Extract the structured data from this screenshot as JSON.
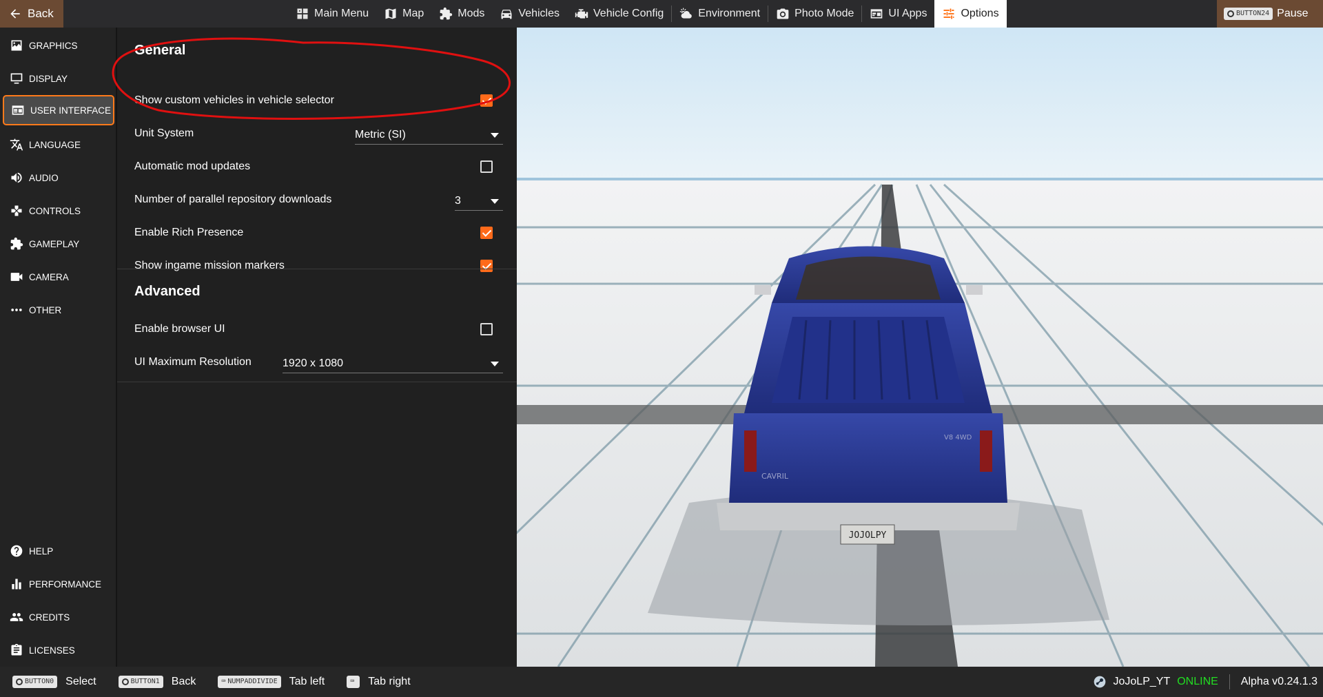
{
  "topbar": {
    "back_label": "Back",
    "tabs": [
      {
        "label": "Main Menu",
        "icon": "main-menu-icon"
      },
      {
        "label": "Map",
        "icon": "map-icon"
      },
      {
        "label": "Mods",
        "icon": "puzzle-icon"
      },
      {
        "label": "Vehicles",
        "icon": "car-icon"
      },
      {
        "label": "Vehicle Config",
        "icon": "engine-icon"
      },
      {
        "label": "Environment",
        "icon": "weather-icon"
      },
      {
        "label": "Photo Mode",
        "icon": "camera-icon"
      },
      {
        "label": "UI Apps",
        "icon": "ui-apps-icon"
      },
      {
        "label": "Options",
        "icon": "sliders-icon",
        "active": true
      }
    ],
    "pause_chip": "BUTTON24",
    "pause_label": "Pause"
  },
  "sidebar": {
    "items": [
      {
        "label": "GRAPHICS",
        "icon": "image-icon"
      },
      {
        "label": "DISPLAY",
        "icon": "monitor-icon"
      },
      {
        "label": "USER INTERFACE",
        "icon": "user-interface-icon",
        "active": true
      },
      {
        "label": "LANGUAGE",
        "icon": "translate-icon"
      },
      {
        "label": "AUDIO",
        "icon": "speaker-icon"
      },
      {
        "label": "CONTROLS",
        "icon": "gamepad-icon"
      },
      {
        "label": "GAMEPLAY",
        "icon": "puzzle-icon"
      },
      {
        "label": "CAMERA",
        "icon": "video-camera-icon"
      },
      {
        "label": "OTHER",
        "icon": "more-icon"
      }
    ],
    "bottom_items": [
      {
        "label": "HELP",
        "icon": "help-icon"
      },
      {
        "label": "PERFORMANCE",
        "icon": "bar-chart-icon"
      },
      {
        "label": "CREDITS",
        "icon": "people-icon"
      },
      {
        "label": "LICENSES",
        "icon": "clipboard-icon"
      }
    ]
  },
  "settings": {
    "general_title": "General",
    "advanced_title": "Advanced",
    "general": [
      {
        "label": "Show custom vehicles in vehicle selector",
        "type": "checkbox",
        "checked": true
      },
      {
        "label": "Unit System",
        "type": "select",
        "value": "Metric (SI)"
      },
      {
        "label": "Automatic mod updates",
        "type": "checkbox",
        "checked": false
      },
      {
        "label": "Number of parallel repository downloads",
        "type": "select",
        "value": "3"
      },
      {
        "label": "Enable Rich Presence",
        "type": "checkbox",
        "checked": true
      },
      {
        "label": "Show ingame mission markers",
        "type": "checkbox",
        "checked": true
      }
    ],
    "advanced": [
      {
        "label": "Enable browser UI",
        "type": "checkbox",
        "checked": false
      },
      {
        "label": "UI Maximum Resolution",
        "type": "select",
        "value": "1920 x 1080"
      }
    ]
  },
  "viewport": {
    "license_plate": "JOJOLPY",
    "badge_left": "CAVRIL",
    "badge_right": "V8 4WD"
  },
  "bottombar": {
    "hints": [
      {
        "chip": "BUTTON0",
        "label": "Select"
      },
      {
        "chip": "BUTTON1",
        "label": "Back"
      },
      {
        "chip": "NUMPADDIVIDE",
        "label": "Tab left"
      },
      {
        "chip": "",
        "label": "Tab right"
      }
    ],
    "username": "JoJoLP_YT",
    "status": "ONLINE",
    "version": "Alpha v0.24.1.3"
  },
  "colors": {
    "accent": "#ff6a1a",
    "online": "#22dd22",
    "annotation": "#e01010"
  }
}
